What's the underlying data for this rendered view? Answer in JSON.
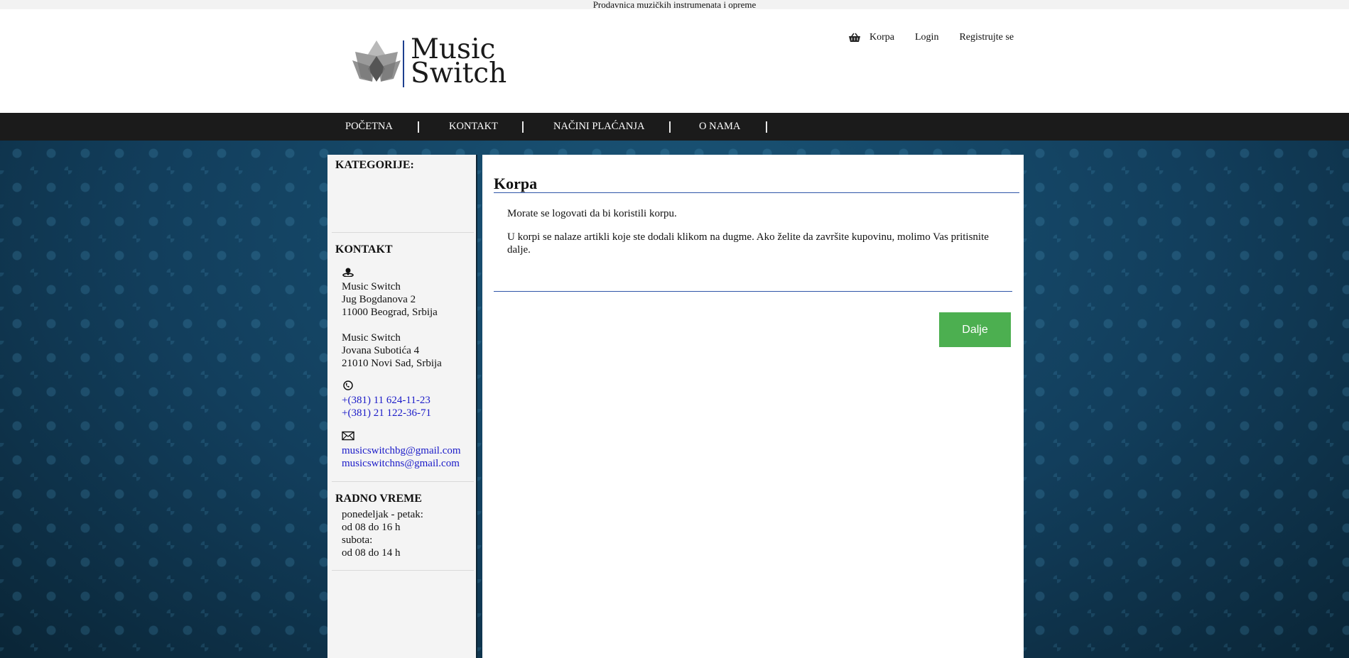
{
  "topbar": {
    "tagline": "Prodavnica muzičkih instrumenata i opreme"
  },
  "logo": {
    "line1": "Music",
    "line2": "Switch"
  },
  "toplinks": {
    "cart": "Korpa",
    "login": "Login",
    "register": "Registrujte se"
  },
  "nav": {
    "items": [
      {
        "label": "POČETNA"
      },
      {
        "label": "KONTAKT"
      },
      {
        "label": "NAČINI PLAĆANJA"
      },
      {
        "label": "O NAMA"
      }
    ]
  },
  "sidebar": {
    "categories_title": "KATEGORIJE:",
    "contact_title": "KONTAKT",
    "address1": [
      "Music Switch",
      "Jug Bogdanova 2",
      "11000 Beograd, Srbija"
    ],
    "address2": [
      "Music Switch",
      "Jovana Subotića 4",
      "21010 Novi Sad, Srbija"
    ],
    "phones": [
      "+(381) 11 624-11-23",
      "+(381) 21 122-36-71"
    ],
    "emails": [
      "musicswitchbg@gmail.com",
      "musicswitchns@gmail.com"
    ],
    "hours_title": "RADNO VREME",
    "hours": [
      "ponedeljak - petak:",
      "od 08 do 16 h",
      "subota:",
      "od 08 do 14 h"
    ]
  },
  "content": {
    "title": "Korpa",
    "message1": "Morate se logovati da bi koristili korpu.",
    "message2": "U korpi se nalaze artikli koje ste dodali klikom na dugme. Ako želite da završite kupovinu, molimo Vas pritisnite dalje.",
    "next_button": "Dalje"
  },
  "colors": {
    "nav_bg": "#1b1b1b",
    "accent_line": "#2e55a8",
    "button_green": "#4caf50",
    "link_blue": "#1a1ac8",
    "logo_bar": "#1d3f8f"
  },
  "icons": {
    "cart": "basket-icon",
    "address": "person-location-icon",
    "phone": "phone-icon",
    "email": "envelope-icon"
  }
}
